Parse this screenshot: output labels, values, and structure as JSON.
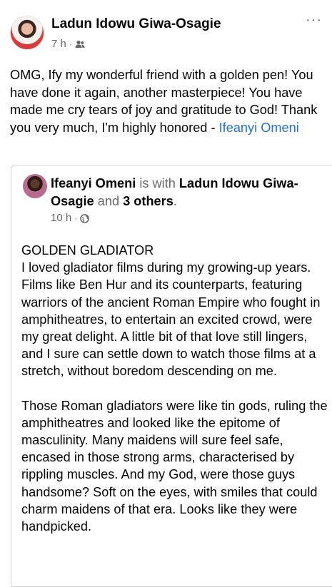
{
  "post": {
    "author": "Ladun Idowu Giwa-Osagie",
    "time": "7 h",
    "separator": "·",
    "more_label": "···",
    "text_main": "OMG, Ify my wonderful friend with a golden pen! You have done it again, another masterpiece! You have made me cry tears of joy and gratitude to God! Thank you very much, I'm highly honored - ",
    "tagged_friend": "Ifeanyi Omeni",
    "audience_icon": "friends-icon"
  },
  "shared_post": {
    "author": "Ifeanyi Omeni",
    "with_text": " is with ",
    "with_person": "Ladun Idowu Giwa-Osagie",
    "and_text": " and ",
    "others": "3 others",
    "period": ".",
    "time": "10 h",
    "separator": "·",
    "audience_icon": "globe-icon",
    "title": "GOLDEN GLADIATOR",
    "paragraph1": "I loved gladiator films during my growing-up years. Films like Ben Hur and its counterparts, featuring warriors of the ancient Roman Empire who fought in amphitheatres, to entertain an excited crowd, were my great delight. A little bit of that love still lingers, and I sure can settle down to watch those films at a stretch, without boredom descending on me.",
    "paragraph2": "Those Roman gladiators were like tin gods, ruling the amphitheatres and looked like the epitome of masculinity. Many maidens will sure feel safe, encased in those strong arms, characterised by rippling muscles. And my God, were those guys handsome? Soft on the eyes, with smiles that could charm maidens of that era. Looks like they were handpicked."
  },
  "colors": {
    "link": "#216fdb",
    "meta": "#65676b",
    "text": "#050505",
    "border": "#ced0d4"
  }
}
